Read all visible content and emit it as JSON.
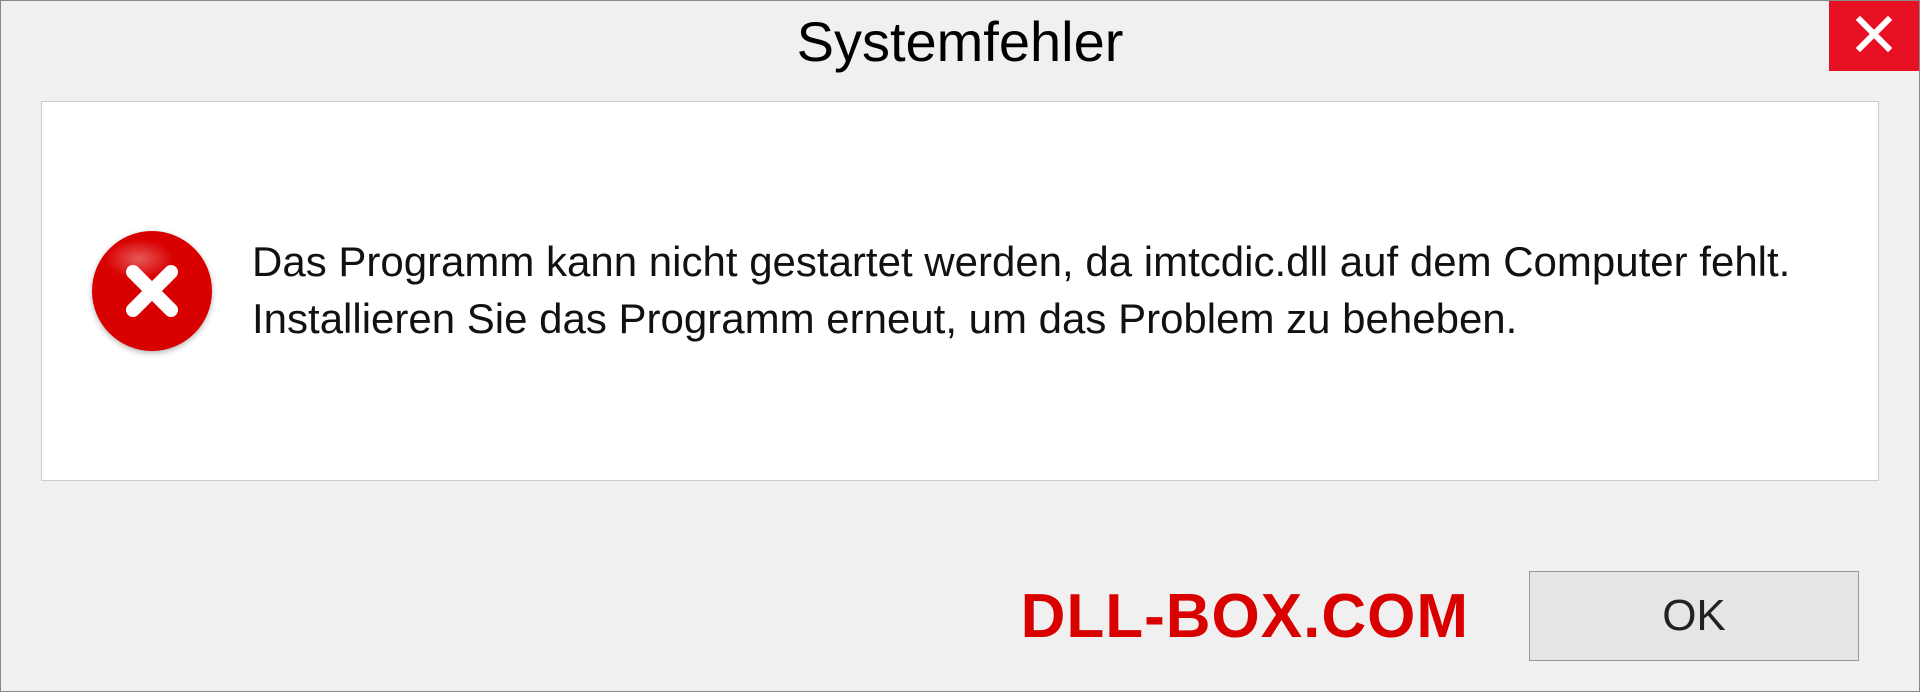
{
  "dialog": {
    "title": "Systemfehler",
    "message": "Das Programm kann nicht gestartet werden, da imtcdic.dll auf dem Computer fehlt. Installieren Sie das Programm erneut, um das Problem zu beheben.",
    "ok_label": "OK"
  },
  "watermark": "DLL-BOX.COM",
  "colors": {
    "error_red": "#d90000",
    "close_red": "#e81123"
  }
}
